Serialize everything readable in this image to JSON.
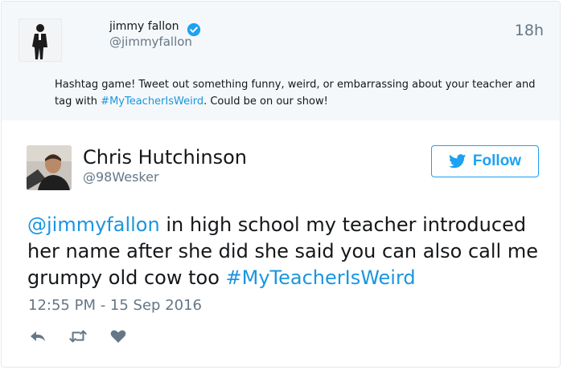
{
  "quoted_tweet": {
    "name": "jimmy fallon",
    "handle": "@jimmyfallon",
    "time": "18h",
    "text_before": "Hashtag game! Tweet out something funny, weird, or embarrassing about your teacher and tag with ",
    "hashtag": "#MyTeacherIsWeird",
    "text_after": ". Could be on our show!",
    "verified_icon": "verified-badge-icon"
  },
  "tweet": {
    "name": "Chris Hutchinson",
    "handle": "@98Wesker",
    "follow_label": "Follow",
    "mention": "@jimmyfallon",
    "body": " in high school my teacher introduced her name after she did she said you can also call me grumpy old cow too ",
    "hashtag": "#MyTeacherIsWeird",
    "date": "12:55 PM - 15 Sep 2016"
  },
  "icons": {
    "reply": "reply-icon",
    "retweet": "retweet-icon",
    "like": "heart-icon",
    "twitter": "twitter-bird-icon"
  },
  "colors": {
    "accent": "#1da1f2",
    "link": "#1b95e0",
    "muted": "#657786",
    "quoted_bg": "#f5f8fa"
  }
}
